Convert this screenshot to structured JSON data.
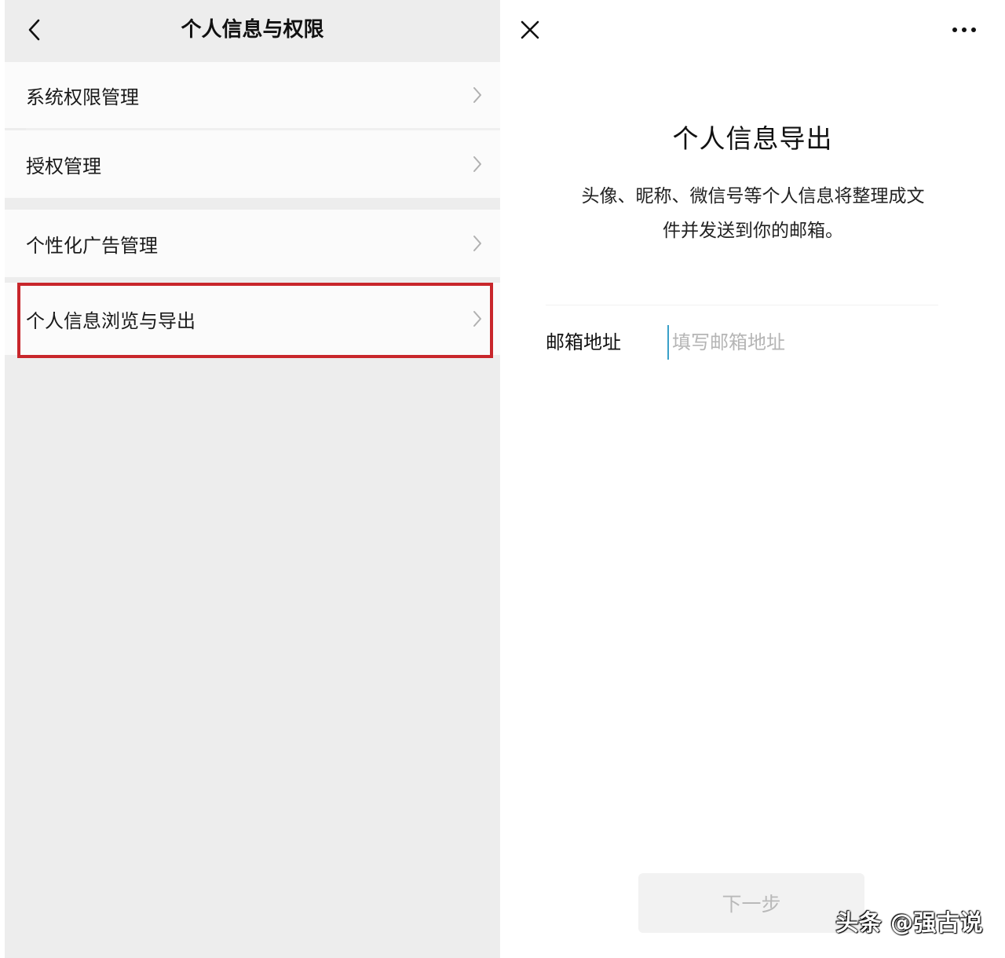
{
  "left": {
    "title": "个人信息与权限",
    "back_icon": "chevron-left-icon",
    "items": [
      {
        "label": "系统权限管理"
      },
      {
        "label": "授权管理"
      },
      {
        "label": "个性化广告管理"
      },
      {
        "label": "个人信息浏览与导出"
      }
    ],
    "highlight_color": "#c8262b"
  },
  "right": {
    "close_icon": "close-icon",
    "more_icon": "more-icon",
    "title": "个人信息导出",
    "description_line1": "头像、昵称、微信号等个人信息将整理成文",
    "description_line2": "件并发送到你的邮箱。",
    "email_label": "邮箱地址",
    "email_value": "",
    "email_placeholder": "填写邮箱地址",
    "next_button": "下一步"
  },
  "watermark": "头条 @强古说"
}
